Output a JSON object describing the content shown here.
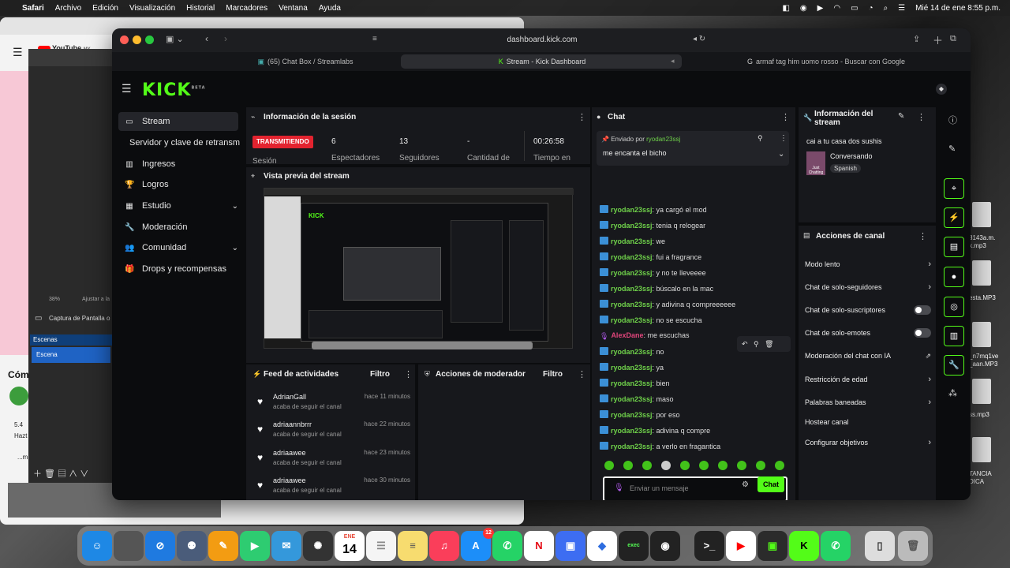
{
  "menubar": {
    "app": "Safari",
    "items": [
      "Archivo",
      "Edición",
      "Visualización",
      "Historial",
      "Marcadores",
      "Ventana",
      "Ayuda"
    ],
    "clock": "Mié 14 de ene  8:55 p.m."
  },
  "background": {
    "yt": "YouTube",
    "yt_region": "MX",
    "obs_zoom": "38%",
    "obs_adjust": "Ajustar a la",
    "obs_capture": "Captura de Pantalla o",
    "obs_scenes": "Escenas",
    "obs_scene": "Escena",
    "com": "Cóm",
    "small1": "5.4",
    "small2": "Hazt",
    "small3": "...m",
    "files": [
      "8143a.m.\nx.mp3",
      "esta.MP3",
      "_n7mq1ve\n_aan.MP3",
      "ss.mp3",
      "TANCIA\nDICA"
    ]
  },
  "browser": {
    "url": "dashboard.kick.com",
    "tabs": [
      "(65) Chat Box / Streamlabs",
      "Stream - Kick Dashboard",
      "armaf tag him uomo rosso - Buscar con Google"
    ]
  },
  "kick": {
    "logo": "KICK",
    "beta": "BETA"
  },
  "sidebar": {
    "items": [
      {
        "label": "Stream",
        "icon": "▭"
      },
      {
        "label": "Servidor y clave de retransm",
        "icon": ""
      },
      {
        "label": "Ingresos",
        "icon": "▥"
      },
      {
        "label": "Logros",
        "icon": "🏆"
      },
      {
        "label": "Estudio",
        "icon": "▦"
      },
      {
        "label": "Moderación",
        "icon": "🔧"
      },
      {
        "label": "Comunidad",
        "icon": "👥"
      },
      {
        "label": "Drops y recompensas",
        "icon": "🎁"
      }
    ]
  },
  "session": {
    "title": "Información de la sesión",
    "status": "TRANSMITIENDO",
    "label_session": "Sesión",
    "stats": [
      {
        "value": "6",
        "label": "Espectadores"
      },
      {
        "value": "13",
        "label": "Seguidores"
      },
      {
        "value": "-",
        "label": "Cantidad de"
      },
      {
        "value": "00:26:58",
        "label": "Tiempo en"
      }
    ]
  },
  "preview": {
    "title": "Vista previa del stream"
  },
  "feed": {
    "title": "Feed de actividades",
    "filter": "Filtro",
    "items": [
      {
        "name": "AdrianGall",
        "sub": "acaba de seguir el canal",
        "time": "hace 11 minutos"
      },
      {
        "name": "adriaannbrrr",
        "sub": "acaba de seguir el canal",
        "time": "hace 22 minutos"
      },
      {
        "name": "adriaawee",
        "sub": "acaba de seguir el canal",
        "time": "hace 23 minutos"
      },
      {
        "name": "adriaawee",
        "sub": "acaba de seguir el canal",
        "time": "hace 30 minutos"
      }
    ]
  },
  "modactions": {
    "title": "Acciones de moderador",
    "filter": "Filtro"
  },
  "chat": {
    "title": "Chat",
    "pinned_prefix": "Enviado por",
    "pinned_user": "ryodan23ssj",
    "pinned_msg": "me encanta el bicho",
    "messages": [
      {
        "user": "ryodan23ssj",
        "text": "ya cargó el mod"
      },
      {
        "user": "ryodan23ssj",
        "text": "tenia q relogear"
      },
      {
        "user": "ryodan23ssj",
        "text": "we"
      },
      {
        "user": "ryodan23ssj",
        "text": "fui a fragrance"
      },
      {
        "user": "ryodan23ssj",
        "text": "y no te lleveeee"
      },
      {
        "user": "ryodan23ssj",
        "text": "búscalo en la mac"
      },
      {
        "user": "ryodan23ssj",
        "text": "y adivina q compreeeeee"
      },
      {
        "user": "ryodan23ssj",
        "text": "no se escucha"
      },
      {
        "user": "AlexDane",
        "text": "me escuchas"
      },
      {
        "user": "ryodan23ssj",
        "text": "no"
      },
      {
        "user": "ryodan23ssj",
        "text": "ya"
      },
      {
        "user": "ryodan23ssj",
        "text": "bien"
      },
      {
        "user": "ryodan23ssj",
        "text": "maso"
      },
      {
        "user": "ryodan23ssj",
        "text": "por eso"
      },
      {
        "user": "ryodan23ssj",
        "text": "adivina q compre"
      },
      {
        "user": "ryodan23ssj",
        "text": "a verlo en fragantica"
      }
    ],
    "placeholder": "Enviar un mensaje",
    "send": "Chat",
    "colors": {
      "user": "#6fd14a",
      "alt_user": "#e0457b",
      "accent": "#53fc18"
    }
  },
  "info": {
    "title": "Información del stream",
    "stream_title": "cai a tu casa dos sushis",
    "category": "Conversando",
    "language": "Spanish",
    "thumb": "Just Chatting"
  },
  "channel_actions": {
    "title": "Acciones de canal",
    "rows": [
      {
        "label": "Modo lento",
        "kind": "chevron"
      },
      {
        "label": "Chat de solo-seguidores",
        "kind": "chevron"
      },
      {
        "label": "Chat de solo-suscriptores",
        "kind": "toggle"
      },
      {
        "label": "Chat de solo-emotes",
        "kind": "toggle"
      },
      {
        "label": "Moderación del chat con IA",
        "kind": "external"
      },
      {
        "label": "Restricción de edad",
        "kind": "chevron"
      },
      {
        "label": "Palabras baneadas",
        "kind": "chevron"
      },
      {
        "label": "Hostear canal",
        "kind": "none"
      },
      {
        "label": "Configurar objetivos",
        "kind": "chevron"
      }
    ]
  },
  "dock": {
    "calendar_month": "ENE",
    "calendar_day": "14",
    "appstore_badge": "12",
    "exec_label": "exec"
  }
}
